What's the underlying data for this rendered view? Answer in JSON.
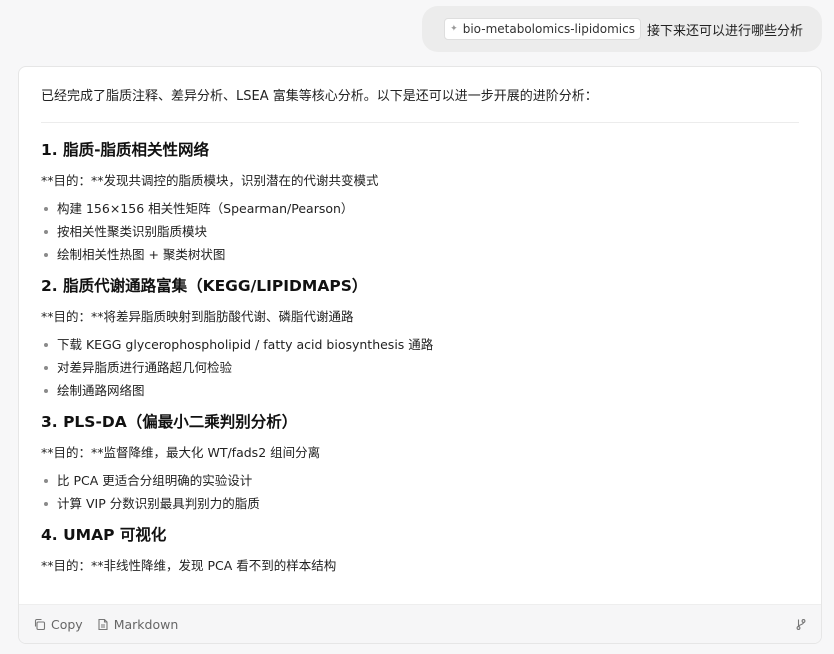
{
  "user_message": {
    "tag": "bio-metabolomics-lipidomics",
    "text": "接下来还可以进行哪些分析"
  },
  "assistant": {
    "intro": "已经完成了脂质注释、差异分析、LSEA 富集等核心分析。以下是还可以进一步开展的进阶分析：",
    "sections": [
      {
        "title": "1. 脂质-脂质相关性网络",
        "purpose": "**目的：**发现共调控的脂质模块，识别潜在的代谢共变模式",
        "items": [
          "构建 156×156 相关性矩阵（Spearman/Pearson）",
          "按相关性聚类识别脂质模块",
          "绘制相关性热图 + 聚类树状图"
        ]
      },
      {
        "title": "2. 脂质代谢通路富集（KEGG/LIPIDMAPS）",
        "purpose": "**目的：**将差异脂质映射到脂肪酸代谢、磷脂代谢通路",
        "items": [
          "下载 KEGG glycerophospholipid / fatty acid biosynthesis 通路",
          "对差异脂质进行通路超几何检验",
          "绘制通路网络图"
        ]
      },
      {
        "title": "3. PLS-DA（偏最小二乘判别分析）",
        "purpose": "**目的：**监督降维，最大化 WT/fads2 组间分离",
        "items": [
          "比 PCA 更适合分组明确的实验设计",
          "计算 VIP 分数识别最具判别力的脂质"
        ]
      },
      {
        "title": "4. UMAP 可视化",
        "purpose": "**目的：**非线性降维，发现 PCA 看不到的样本结构",
        "items": []
      }
    ]
  },
  "footer": {
    "copy_label": "Copy",
    "markdown_label": "Markdown",
    "icons": [
      "copy-icon",
      "document-icon",
      "branch-icon"
    ]
  }
}
